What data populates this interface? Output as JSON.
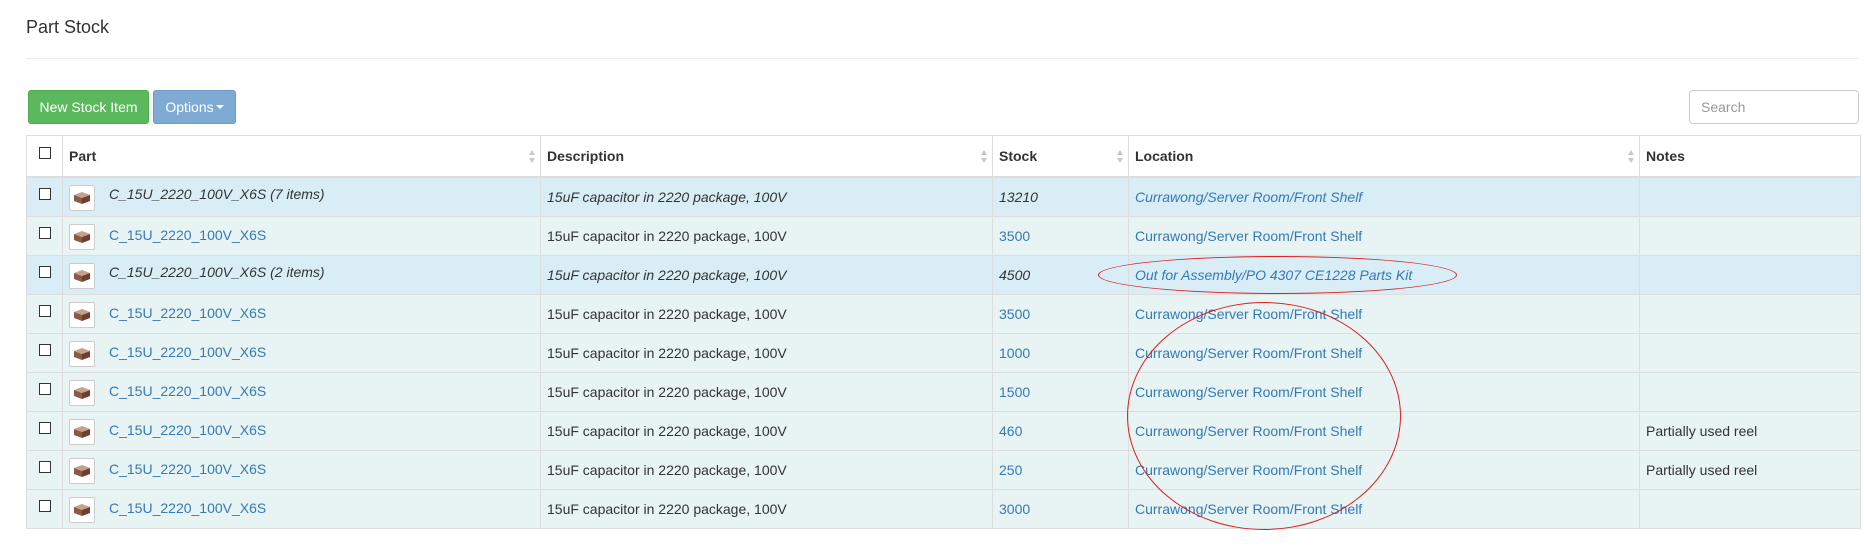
{
  "page": {
    "title": "Part Stock"
  },
  "toolbar": {
    "new_label": "New Stock Item",
    "options_label": "Options",
    "search_placeholder": "Search"
  },
  "columns": {
    "part": "Part",
    "description": "Description",
    "stock": "Stock",
    "location": "Location",
    "notes": "Notes"
  },
  "rows": [
    {
      "type": "group",
      "part": "C_15U_2220_100V_X6S (7 items)",
      "description": "15uF capacitor in 2220 package, 100V",
      "stock": "13210",
      "location": "Currawong/Server Room/Front Shelf",
      "notes": ""
    },
    {
      "type": "item",
      "part": "C_15U_2220_100V_X6S",
      "description": "15uF capacitor in 2220 package, 100V",
      "stock": "3500",
      "location": "Currawong/Server Room/Front Shelf",
      "notes": ""
    },
    {
      "type": "group",
      "part": "C_15U_2220_100V_X6S (2 items)",
      "description": "15uF capacitor in 2220 package, 100V",
      "stock": "4500",
      "location": "Out for Assembly/PO 4307 CE1228 Parts Kit",
      "notes": ""
    },
    {
      "type": "item",
      "part": "C_15U_2220_100V_X6S",
      "description": "15uF capacitor in 2220 package, 100V",
      "stock": "3500",
      "location": "Currawong/Server Room/Front Shelf",
      "notes": ""
    },
    {
      "type": "item",
      "part": "C_15U_2220_100V_X6S",
      "description": "15uF capacitor in 2220 package, 100V",
      "stock": "1000",
      "location": "Currawong/Server Room/Front Shelf",
      "notes": ""
    },
    {
      "type": "item",
      "part": "C_15U_2220_100V_X6S",
      "description": "15uF capacitor in 2220 package, 100V",
      "stock": "1500",
      "location": "Currawong/Server Room/Front Shelf",
      "notes": ""
    },
    {
      "type": "item",
      "part": "C_15U_2220_100V_X6S",
      "description": "15uF capacitor in 2220 package, 100V",
      "stock": "460",
      "location": "Currawong/Server Room/Front Shelf",
      "notes": "Partially used reel"
    },
    {
      "type": "item",
      "part": "C_15U_2220_100V_X6S",
      "description": "15uF capacitor in 2220 package, 100V",
      "stock": "250",
      "location": "Currawong/Server Room/Front Shelf",
      "notes": "Partially used reel"
    },
    {
      "type": "item",
      "part": "C_15U_2220_100V_X6S",
      "description": "15uF capacitor in 2220 package, 100V",
      "stock": "3000",
      "location": "Currawong/Server Room/Front Shelf",
      "notes": ""
    }
  ],
  "colors": {
    "new_button": "#5cb85c",
    "options_button": "#7eaad4",
    "group_row": "#d9edf7",
    "item_row": "#e8f3f3",
    "link": "#337ab7",
    "annotation": "#d92020"
  }
}
